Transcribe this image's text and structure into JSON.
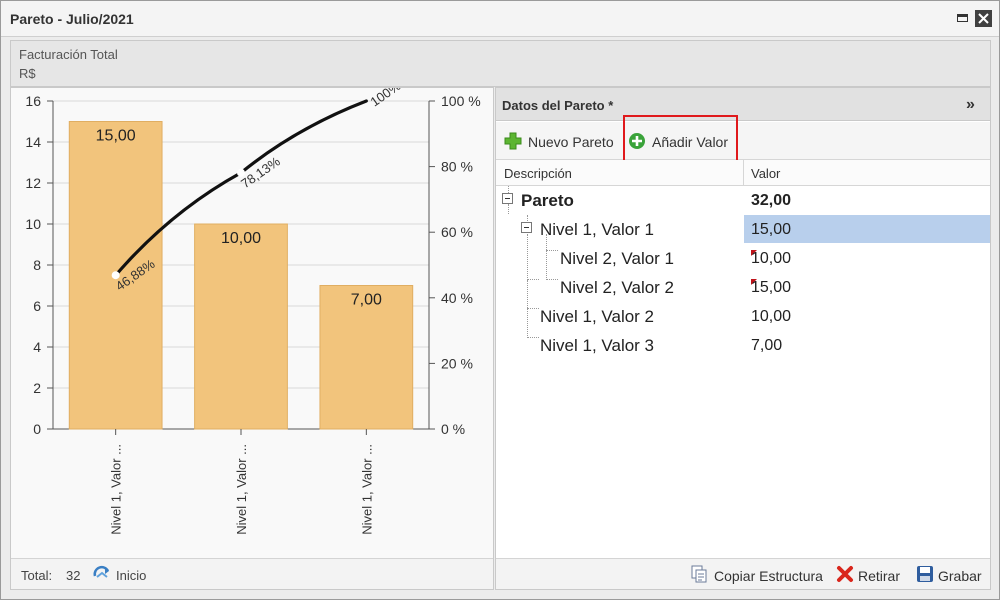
{
  "window": {
    "title": "Pareto - Julio/2021"
  },
  "header": {
    "title": "Facturación Total",
    "subtitle": "R$"
  },
  "chart_data": {
    "type": "bar",
    "categories": [
      "Nivel 1, Valor ...",
      "Nivel 1, Valor ...",
      "Nivel 1, Valor ..."
    ],
    "values": [
      15,
      10,
      7
    ],
    "value_labels": [
      "15,00",
      "10,00",
      "7,00"
    ],
    "bar_color": "#f2c47c",
    "cumulative_line": {
      "values_percent": [
        46.88,
        78.13,
        100
      ],
      "labels": [
        "46,88%",
        "78,13%",
        "100%"
      ],
      "color": "#111111"
    },
    "y_left": {
      "min": 0,
      "max": 16,
      "ticks": [
        0,
        2,
        4,
        6,
        8,
        10,
        12,
        14,
        16
      ]
    },
    "y_right": {
      "min": 0,
      "max": 100,
      "ticks": [
        "0 %",
        "20 %",
        "40 %",
        "60 %",
        "80 %",
        "100 %"
      ]
    },
    "grid": true
  },
  "chart_footer": {
    "total_label": "Total:",
    "total_value": "32",
    "inicio_label": "Inicio"
  },
  "data_panel": {
    "title": "Datos del Pareto *",
    "collapse_glyph": "»",
    "toolbar": {
      "nuevo_pareto": "Nuevo Pareto",
      "anadir_valor": "Añadir Valor"
    },
    "columns": {
      "descripcion": "Descripción",
      "valor": "Valor"
    },
    "rows": [
      {
        "label": "Pareto",
        "value": "32,00"
      },
      {
        "label": "Nivel 1, Valor 1",
        "value": "15,00"
      },
      {
        "label": "Nivel 2, Valor 1",
        "value": "10,00"
      },
      {
        "label": "Nivel 2, Valor 2",
        "value": "15,00"
      },
      {
        "label": "Nivel 1, Valor 2",
        "value": "10,00"
      },
      {
        "label": "Nivel 1, Valor 3",
        "value": "7,00"
      }
    ],
    "footer": {
      "copiar": "Copiar Estructura",
      "retirar": "Retirar",
      "grabar": "Grabar"
    }
  }
}
